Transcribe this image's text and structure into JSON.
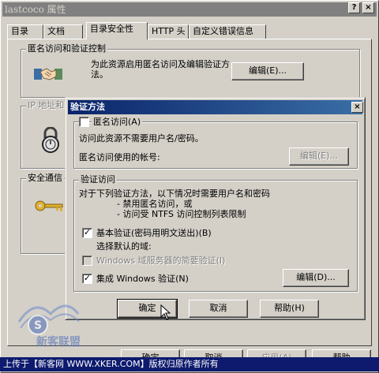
{
  "outer": {
    "title": "lastcoco 属性",
    "help_btn": "?",
    "close_btn": "×",
    "tabs": [
      "目录",
      "文档",
      "目录安全性",
      "HTTP 头",
      "自定义错误信息"
    ],
    "anon_group_title": "匿名访问和验证控制",
    "anon_desc": "为此资源启用匿名访问及编辑验证方法。",
    "anon_edit_btn": "编辑(E)...",
    "ip_group_title": "IP 地址和",
    "secure_group_title": "安全通信",
    "bottom_buttons": [
      "确定",
      "取消",
      "应用(A)",
      "帮助"
    ]
  },
  "dialog": {
    "title": "验证方法",
    "close_btn": "×",
    "anon_checkbox_label": "匿名访问(A)",
    "anon_desc": "访问此资源不需要用户名/密码。",
    "anon_account_label": "匿名访问使用的帐号:",
    "anon_edit_btn": "编辑(E)...",
    "auth_group_title": "验证访问",
    "auth_desc_line1": "对于下列验证方法，以下情况时需要用户名和密码",
    "auth_desc_line2": "- 禁用匿名访问，或",
    "auth_desc_line3": "- 访问受 NTFS 访问控制列表限制",
    "basic_auth_label": "基本验证(密码用明文送出)(B)",
    "select_domain_label": "选择默认的域:",
    "digest_auth_label": "Windows 域服务器的简要验证(I)",
    "integrated_auth_label": "集成 Windows 验证(N)",
    "auth_edit_btn": "编辑(D)...",
    "ok_btn": "确定",
    "cancel_btn": "取消",
    "help_btn": "帮助(H)"
  },
  "checkbox_states": {
    "anonymous": false,
    "basic": true,
    "digest": false,
    "integrated": true
  },
  "watermark": {
    "text": "上传于【新客网 WWW.XKER.COM】版权归原作者所有",
    "logo_text": "新客联盟"
  },
  "colors": {
    "dialog_face": "#d4d0c8",
    "active_title": "#0a246a",
    "inactive_title": "#808080",
    "watermark_bar": "#0d1a6e"
  }
}
